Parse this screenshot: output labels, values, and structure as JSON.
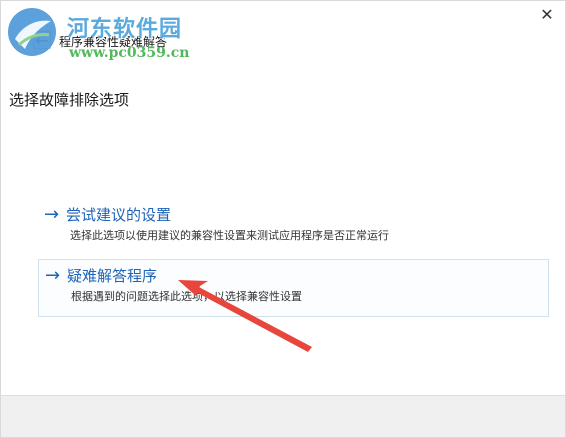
{
  "window": {
    "title": "程序兼容性疑难解答",
    "back_glyph": "←",
    "close_glyph": "✕"
  },
  "watermark": {
    "site_name": "河东软件园",
    "url": "www.pc0359.cn",
    "colors": {
      "title": "#5aa9df",
      "url": "#52b85a",
      "logo": "#3f8fd6"
    }
  },
  "main": {
    "heading": "选择故障排除选项",
    "options": [
      {
        "arrow": "→",
        "title": "尝试建议的设置",
        "description": "选择此选项以使用建议的兼容性设置来测试应用程序是否正常运行"
      },
      {
        "arrow": "→",
        "title": "疑难解答程序",
        "description": "根据遇到的问题选择此选项，以选择兼容性设置"
      }
    ]
  },
  "annotation": {
    "arrow_color": "#e8453c"
  },
  "colors": {
    "link": "#1e64b8",
    "footer": "#f0f0f0"
  }
}
